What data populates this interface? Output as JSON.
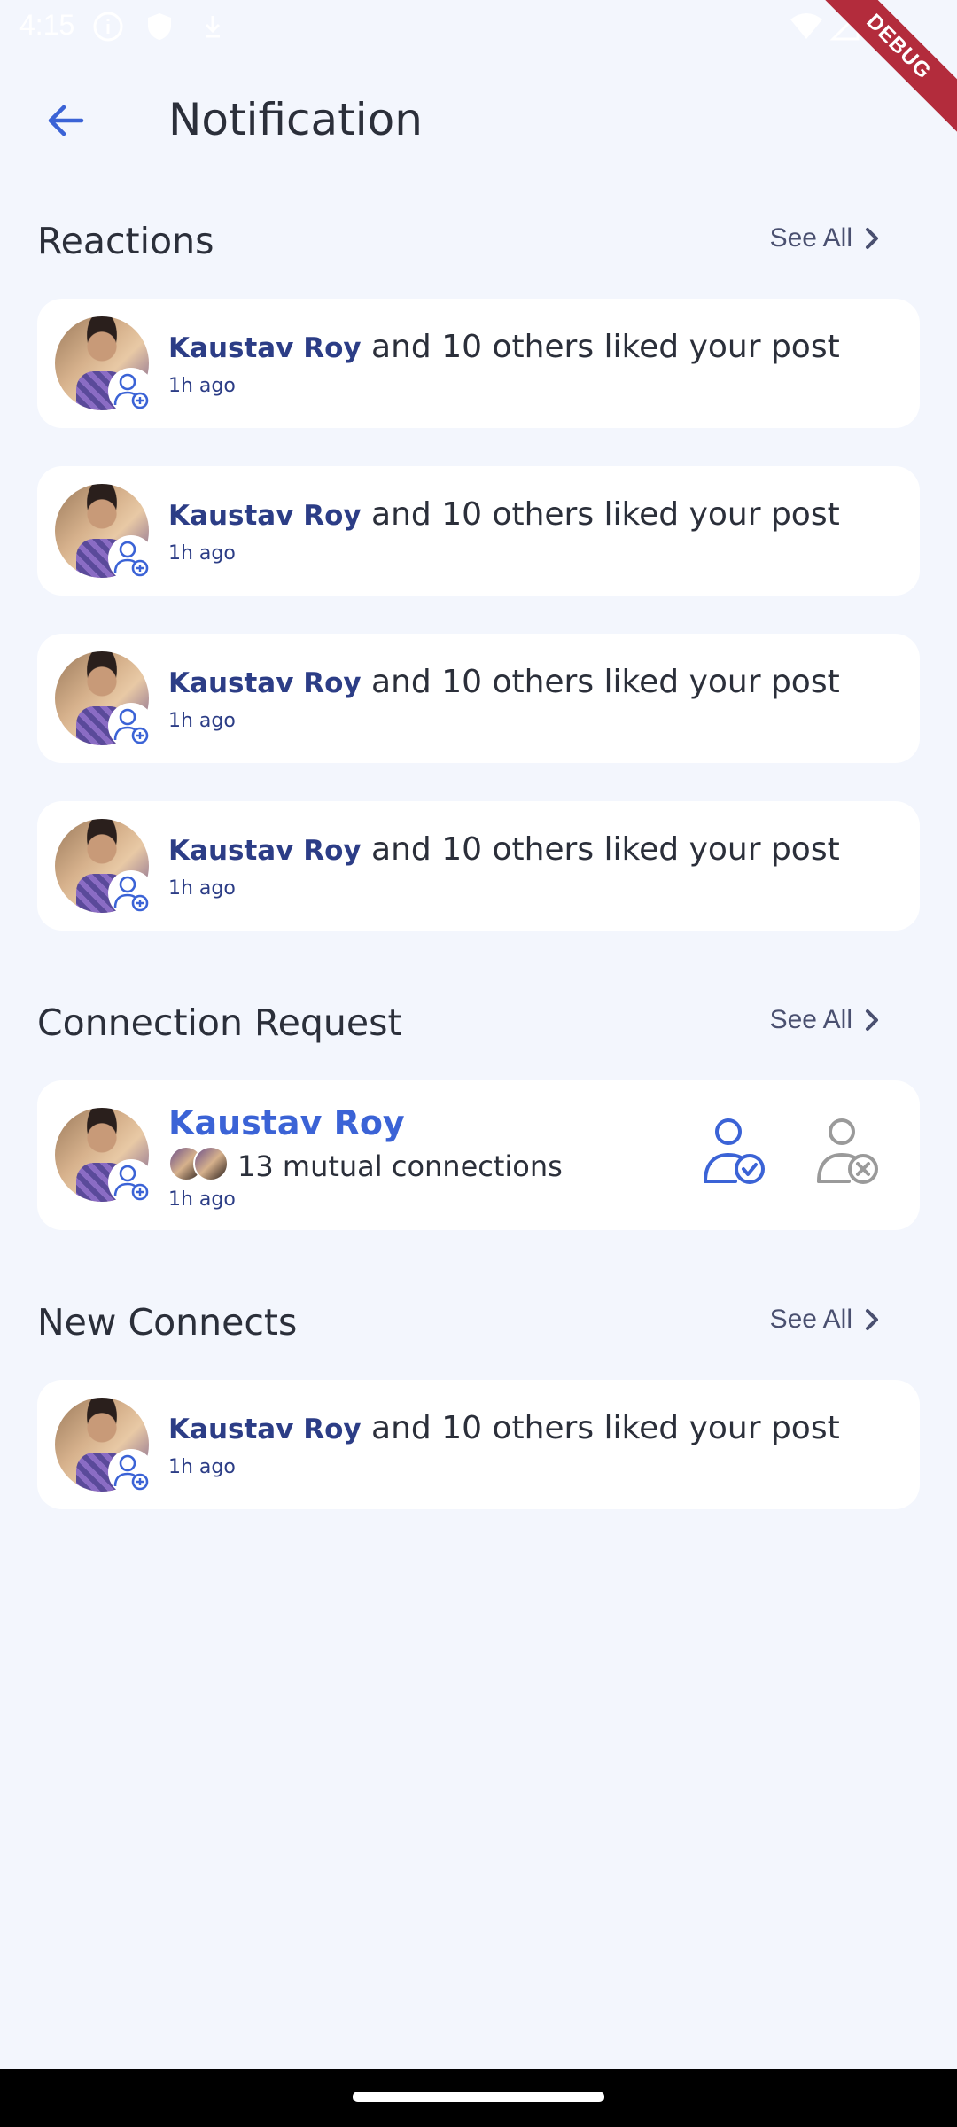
{
  "status_bar": {
    "time": "4:15"
  },
  "debug_banner": "DEBUG",
  "header": {
    "title": "Notification"
  },
  "sections": {
    "reactions": {
      "title": "Reactions",
      "see_all": "See All",
      "items": [
        {
          "name": "Kaustav Roy",
          "text": " and 10 others liked your post",
          "time": "1h ago"
        },
        {
          "name": "Kaustav Roy",
          "text": " and 10 others liked your post",
          "time": "1h ago"
        },
        {
          "name": "Kaustav Roy",
          "text": " and 10 others liked your post",
          "time": "1h ago"
        },
        {
          "name": "Kaustav Roy",
          "text": " and 10 others liked your post",
          "time": "1h ago"
        }
      ]
    },
    "connection_request": {
      "title": "Connection Request",
      "see_all": "See All",
      "item": {
        "name": "Kaustav Roy",
        "mutual": "13 mutual connections",
        "time": "1h ago"
      }
    },
    "new_connects": {
      "title": "New Connects",
      "see_all": "See All",
      "items": [
        {
          "name": "Kaustav Roy",
          "text": " and 10 others liked your post",
          "time": "1h ago"
        }
      ]
    }
  },
  "colors": {
    "accent": "#3b63d6",
    "name": "#2c3d86",
    "background": "#f3f6fd",
    "card": "#ffffff"
  },
  "icons": [
    "back-arrow-icon",
    "chevron-right-icon",
    "add-user-icon",
    "accept-user-icon",
    "reject-user-icon"
  ]
}
